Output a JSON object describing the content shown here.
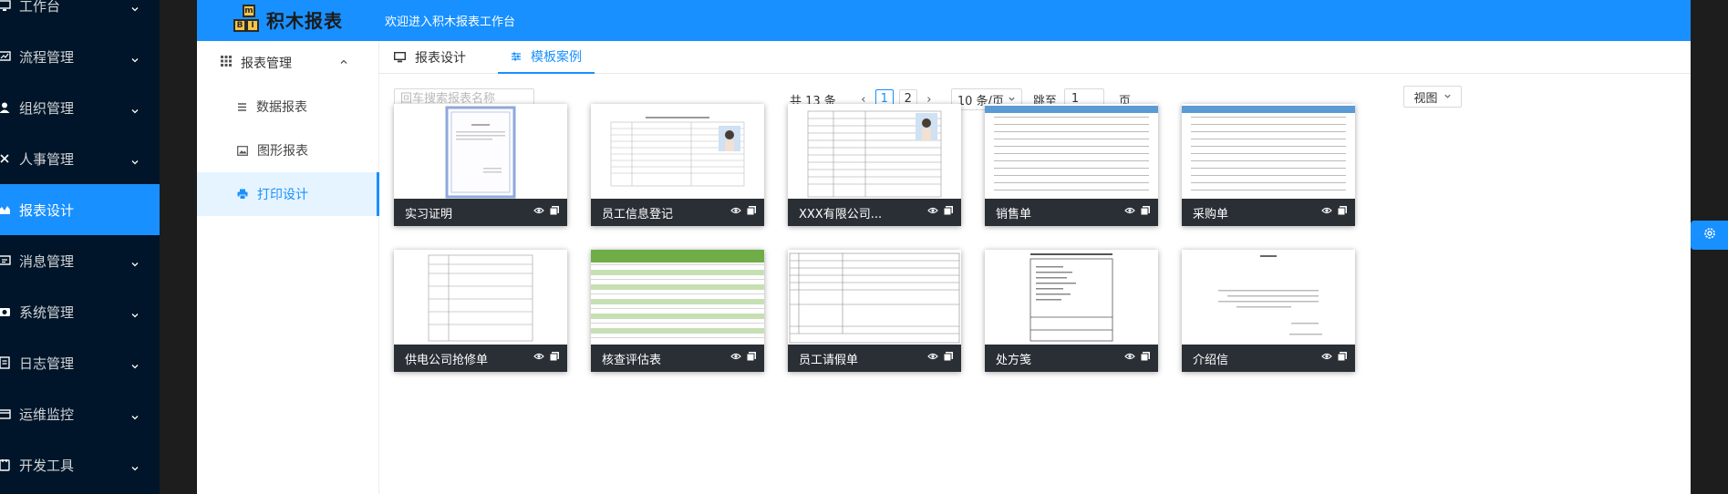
{
  "sidebar": {
    "items": [
      {
        "label": "工作台",
        "icon": "monitor-icon"
      },
      {
        "label": "流程管理",
        "icon": "flow-icon"
      },
      {
        "label": "组织管理",
        "icon": "user-icon"
      },
      {
        "label": "人事管理",
        "icon": "close-icon"
      },
      {
        "label": "报表设计",
        "icon": "chart-area-icon"
      },
      {
        "label": "消息管理",
        "icon": "message-icon"
      },
      {
        "label": "系统管理",
        "icon": "camera-icon"
      },
      {
        "label": "日志管理",
        "icon": "log-icon"
      },
      {
        "label": "运维监控",
        "icon": "card-icon"
      },
      {
        "label": "开发工具",
        "icon": "tool-icon"
      }
    ],
    "active": "报表设计"
  },
  "header": {
    "logo_text": "积木报表",
    "logo_letters": [
      "m",
      "B",
      "I"
    ],
    "welcome": "欢迎进入积木报表工作台"
  },
  "submenu": {
    "group": "报表管理",
    "items": [
      {
        "label": "数据报表"
      },
      {
        "label": "图形报表"
      },
      {
        "label": "打印设计"
      }
    ],
    "active": "打印设计"
  },
  "tabs": [
    {
      "label": "报表设计"
    },
    {
      "label": "模板案例"
    }
  ],
  "active_tab": "模板案例",
  "search": {
    "placeholder": "回车搜索报表名称"
  },
  "pager": {
    "total": "共 13 条",
    "pages": [
      "1",
      "2"
    ],
    "current": "1",
    "page_size": "10 条/页",
    "jump_label": "跳至",
    "jump_value": "1",
    "page_word": "页"
  },
  "view_button": "视图",
  "cards": [
    {
      "name": "实习证明"
    },
    {
      "name": "员工信息登记"
    },
    {
      "name": "XXX有限公司..."
    },
    {
      "name": "销售单"
    },
    {
      "name": "采购单"
    },
    {
      "name": "供电公司抢修单"
    },
    {
      "name": "核查评估表"
    },
    {
      "name": "员工请假单"
    },
    {
      "name": "处方笺"
    },
    {
      "name": "介绍信"
    }
  ],
  "colors": {
    "primary": "#1890ff",
    "sidebar_bg": "#001529",
    "card_bar": "#2a2f36"
  }
}
